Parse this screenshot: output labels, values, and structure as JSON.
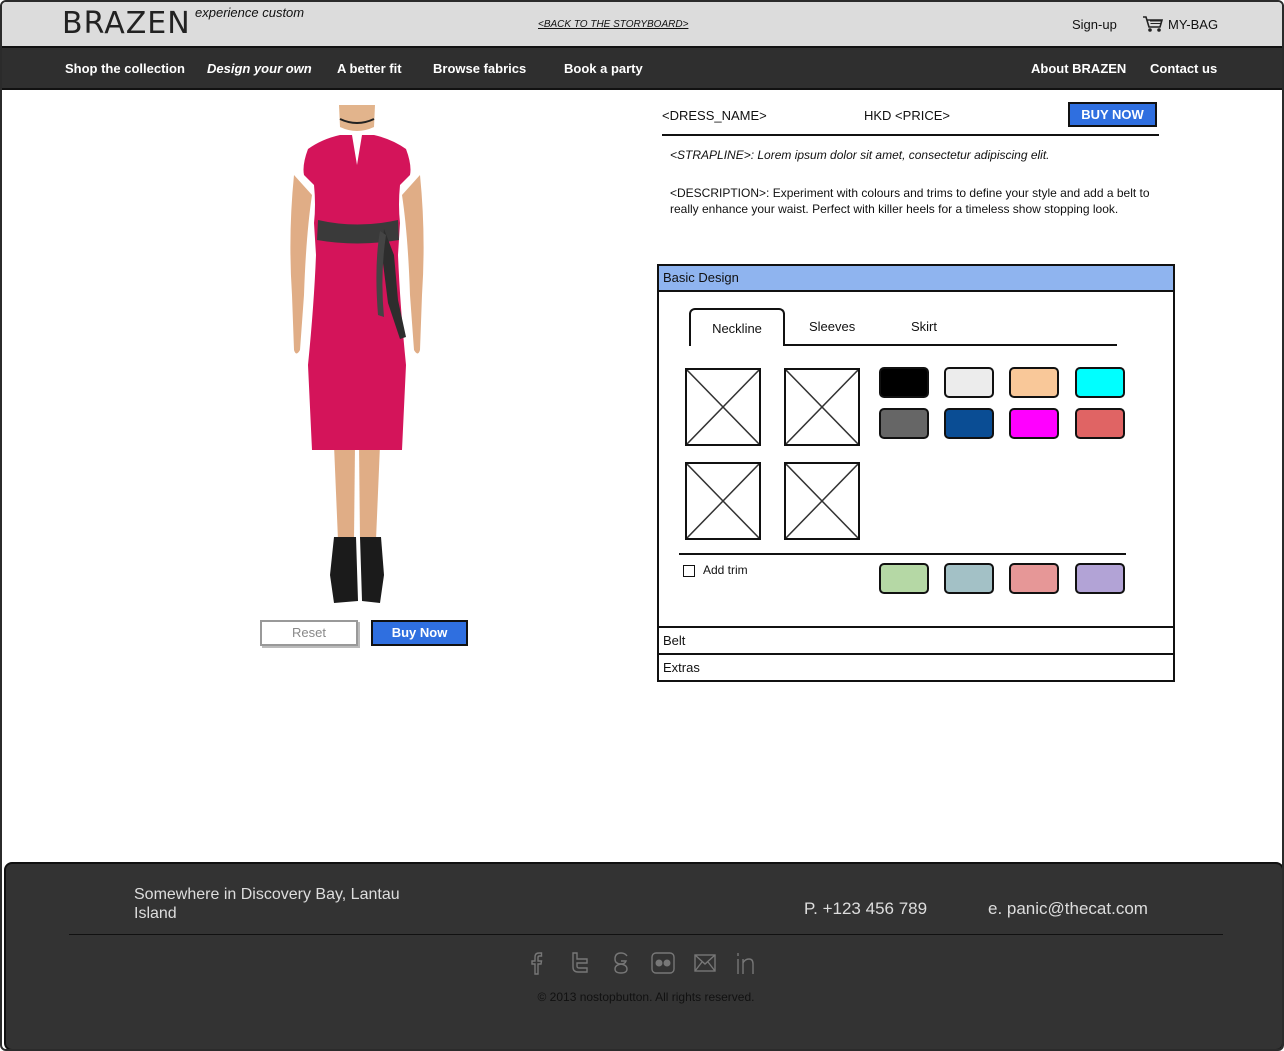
{
  "header": {
    "logo": "BRAZEN",
    "tagline": "experience custom",
    "back_link": "<BACK TO THE STORYBOARD>",
    "signup": "Sign-up",
    "bag": "MY-BAG"
  },
  "nav": {
    "items": [
      {
        "label": "Shop the collection"
      },
      {
        "label": "Design your own"
      },
      {
        "label": "A better fit"
      },
      {
        "label": "Browse fabrics"
      },
      {
        "label": "Book a party"
      },
      {
        "label": "About BRAZEN"
      },
      {
        "label": "Contact us"
      }
    ]
  },
  "preview": {
    "reset_label": "Reset",
    "buy_label": "Buy Now"
  },
  "product": {
    "name": "<DRESS_NAME>",
    "price": "HKD <PRICE>",
    "buy_now": "BUY NOW",
    "strapline": "<STRAPLINE>: Lorem ipsum dolor sit amet, consectetur adipiscing elit.",
    "description": "<DESCRIPTION>: Experiment with colours and trims to define your style and add a belt to really enhance your waist. Perfect with killer heels for a timeless show stopping look."
  },
  "designer": {
    "section_basic": "Basic Design",
    "tabs": [
      {
        "label": "Neckline"
      },
      {
        "label": "Sleeves"
      },
      {
        "label": "Skirt"
      }
    ],
    "color_swatches": [
      "#000000",
      "#ececec",
      "#f9c899",
      "#00ffff",
      "#666666",
      "#0a4d94",
      "#ff00ff",
      "#e06464"
    ],
    "add_trim_label": "Add trim",
    "trim_swatches": [
      "#b5d8a5",
      "#a3c1c6",
      "#e69797",
      "#b2a3d6"
    ],
    "section_belt": "Belt",
    "section_extras": "Extras"
  },
  "footer": {
    "address": "Somewhere in Discovery Bay, Lantau Island",
    "phone": "P. +123 456 789",
    "email": "e. panic@thecat.com",
    "social_icons": [
      "facebook-icon",
      "twitter-icon",
      "google-plus-icon",
      "flickr-icon",
      "email-icon",
      "linkedin-icon"
    ],
    "copyright": "© 2013 nostopbutton. All rights reserved."
  }
}
